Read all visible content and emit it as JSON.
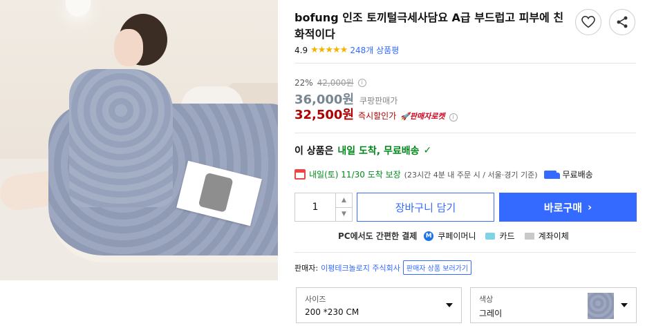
{
  "product": {
    "title": "bofung 인조 토끼털극세사담요 A급 부드럽고 피부에 친화적이다",
    "rating_value": "4.9",
    "stars": "★★★★★",
    "review_count": "248개 상품평"
  },
  "pricing": {
    "discount_rate": "22%",
    "original_price": "42,000원",
    "coupang_price": "36,000원",
    "coupang_price_label": "쿠팡판매가",
    "instant_price": "32,500원",
    "instant_price_label": "즉시할인가",
    "rocket_label": "🚀판매자로켓",
    "info_glyph": "i"
  },
  "shipping": {
    "free_shipping_text": "이 상품은 내일 도착, 무료배송",
    "free_shipping_prefix": "이 상품은",
    "free_shipping_highlight": "내일 도착, 무료배송",
    "check_glyph": "✓",
    "delivery_date": "내일(토) 11/30 도착 보장",
    "delivery_note": "(23시간 4분  내 주문 시 / 서울·경기 기준)",
    "free_label": "무료배송"
  },
  "purchase": {
    "quantity": "1",
    "qty_up": "▲",
    "qty_down": "▼",
    "cart_label": "장바구니 담기",
    "buy_label": "바로구매",
    "buy_chevron": "›"
  },
  "payment": {
    "lead": "PC에서도 간편한 결제",
    "m_badge": "M",
    "coupay": "쿠페이머니",
    "card": "카드",
    "bank": "계좌이체"
  },
  "seller": {
    "label": "판매자:",
    "name": "이평테크놀로지 주식회사",
    "button": "판매자 상품 보러가기"
  },
  "options": {
    "size_caption": "사이즈",
    "size_value": "200 *230 CM",
    "color_caption": "색상",
    "color_value": "그레이"
  },
  "colors": {
    "accent": "#346aff",
    "instant_red": "#ae0000",
    "green": "#00891a",
    "star": "#f5b200"
  }
}
